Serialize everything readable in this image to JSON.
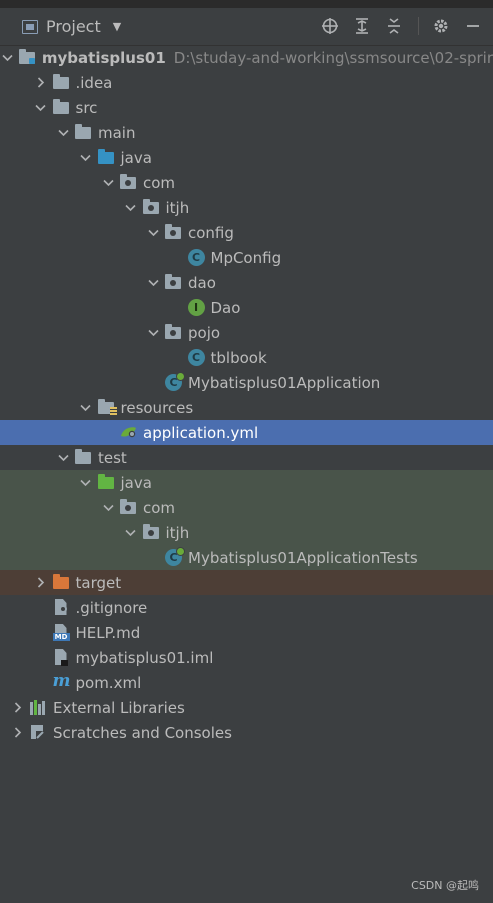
{
  "header": {
    "title": "Project",
    "tools": [
      "crosshair-icon",
      "expand-all-icon",
      "collapse-all-icon",
      "gear-icon",
      "minimize-icon"
    ]
  },
  "tree": [
    {
      "label": "mybatisplus01",
      "path": "D:\\studay-and-working\\ssmsource\\02-sprir",
      "depth": 0,
      "arrow": "down",
      "icon": "module-folder",
      "bold": true
    },
    {
      "label": ".idea",
      "depth": 1,
      "arrow": "right",
      "icon": "folder"
    },
    {
      "label": "src",
      "depth": 1,
      "arrow": "down",
      "icon": "folder"
    },
    {
      "label": "main",
      "depth": 2,
      "arrow": "down",
      "icon": "folder"
    },
    {
      "label": "java",
      "depth": 3,
      "arrow": "down",
      "icon": "source-folder"
    },
    {
      "label": "com",
      "depth": 4,
      "arrow": "down",
      "icon": "package"
    },
    {
      "label": "itjh",
      "depth": 5,
      "arrow": "down",
      "icon": "package"
    },
    {
      "label": "config",
      "depth": 6,
      "arrow": "down",
      "icon": "package"
    },
    {
      "label": "MpConfig",
      "depth": 7,
      "arrow": "none",
      "icon": "class"
    },
    {
      "label": "dao",
      "depth": 6,
      "arrow": "down",
      "icon": "package"
    },
    {
      "label": "Dao",
      "depth": 7,
      "arrow": "none",
      "icon": "interface"
    },
    {
      "label": "pojo",
      "depth": 6,
      "arrow": "down",
      "icon": "package"
    },
    {
      "label": "tblbook",
      "depth": 7,
      "arrow": "none",
      "icon": "class"
    },
    {
      "label": "Mybatisplus01Application",
      "depth": 6,
      "arrow": "none",
      "icon": "boot-class"
    },
    {
      "label": "resources",
      "depth": 3,
      "arrow": "down",
      "icon": "resources-folder"
    },
    {
      "label": "application.yml",
      "depth": 4,
      "arrow": "none",
      "icon": "yml",
      "state": "selected"
    },
    {
      "label": "test",
      "depth": 2,
      "arrow": "down",
      "icon": "folder"
    },
    {
      "label": "java",
      "depth": 3,
      "arrow": "down",
      "icon": "test-folder",
      "state": "test"
    },
    {
      "label": "com",
      "depth": 4,
      "arrow": "down",
      "icon": "package",
      "state": "test"
    },
    {
      "label": "itjh",
      "depth": 5,
      "arrow": "down",
      "icon": "package",
      "state": "test"
    },
    {
      "label": "Mybatisplus01ApplicationTests",
      "depth": 6,
      "arrow": "none",
      "icon": "boot-class",
      "state": "test"
    },
    {
      "label": "target",
      "depth": 1,
      "arrow": "right",
      "icon": "excluded-folder",
      "state": "excluded"
    },
    {
      "label": ".gitignore",
      "depth": 1,
      "arrow": "none",
      "icon": "gitignore-file"
    },
    {
      "label": "HELP.md",
      "depth": 1,
      "arrow": "none",
      "icon": "md-file"
    },
    {
      "label": "mybatisplus01.iml",
      "depth": 1,
      "arrow": "none",
      "icon": "iml-file"
    },
    {
      "label": "pom.xml",
      "depth": 1,
      "arrow": "none",
      "icon": "maven-file"
    },
    {
      "label": "External Libraries",
      "depth": 0,
      "arrow": "right",
      "icon": "libraries"
    },
    {
      "label": "Scratches and Consoles",
      "depth": 0,
      "arrow": "right",
      "icon": "scratches"
    }
  ],
  "watermark": "CSDN @起鸣",
  "colors": {
    "background": "#3c3f41",
    "selected": "#4b6eaf",
    "test_row": "#49544a",
    "excluded_row": "#4d3e36"
  }
}
